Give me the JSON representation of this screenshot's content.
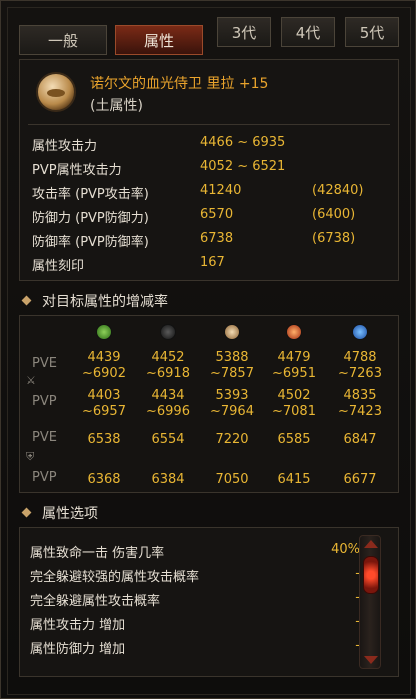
{
  "tabs": [
    "一般",
    "属性",
    "3代",
    "4代",
    "5代"
  ],
  "item": {
    "name": "诺尔文的血光侍卫 里拉 +15",
    "subtitle": "(土属性)",
    "icon": "earth-icon"
  },
  "stats": [
    {
      "label": "属性攻击力",
      "v1": "4466 ~ 6935",
      "v2": ""
    },
    {
      "label": "PVP属性攻击力",
      "v1": "4052 ~ 6521",
      "v2": ""
    },
    {
      "label": "攻击率 (PVP攻击率)",
      "v1": "41240",
      "v2": "(42840)"
    },
    {
      "label": "防御力 (PVP防御力)",
      "v1": "6570",
      "v2": "(6400)"
    },
    {
      "label": "防御率 (PVP防御率)",
      "v1": "6738",
      "v2": "(6738)"
    },
    {
      "label": "属性刻印",
      "v1": "167",
      "v2": ""
    }
  ],
  "section_elements": "对目标属性的增减率",
  "element_icons": [
    {
      "icon": "wind-icon",
      "color": "#4a9a2a"
    },
    {
      "icon": "dark-icon",
      "color": "#2a2a2a"
    },
    {
      "icon": "earth-icon",
      "color": "#c9a46a"
    },
    {
      "icon": "fire-icon",
      "color": "#c0441e"
    },
    {
      "icon": "water-icon",
      "color": "#2a6ac0"
    }
  ],
  "atk_rows": [
    {
      "label": "PVE",
      "values": [
        "4439\n~6902",
        "4452\n~6918",
        "5388\n~7857",
        "4479\n~6951",
        "4788\n~7263"
      ]
    },
    {
      "label": "PVP",
      "values": [
        "4403\n~6957",
        "4434\n~6996",
        "5393\n~7964",
        "4502\n~7081",
        "4835\n~7423"
      ]
    }
  ],
  "def_rows": [
    {
      "label": "PVE",
      "values": [
        "6538",
        "6554",
        "7220",
        "6585",
        "6847"
      ]
    },
    {
      "label": "PVP",
      "values": [
        "6368",
        "6384",
        "7050",
        "6415",
        "6677"
      ]
    }
  ],
  "section_options": "属性选项",
  "options": [
    {
      "label": "属性致命一击 伤害几率",
      "value": "40%"
    },
    {
      "label": "完全躲避较强的属性攻击概率",
      "value": "-"
    },
    {
      "label": "完全躲避属性攻击概率",
      "value": "-"
    },
    {
      "label": "属性攻击力 增加",
      "value": "-"
    },
    {
      "label": "属性防御力 增加",
      "value": "-"
    }
  ]
}
